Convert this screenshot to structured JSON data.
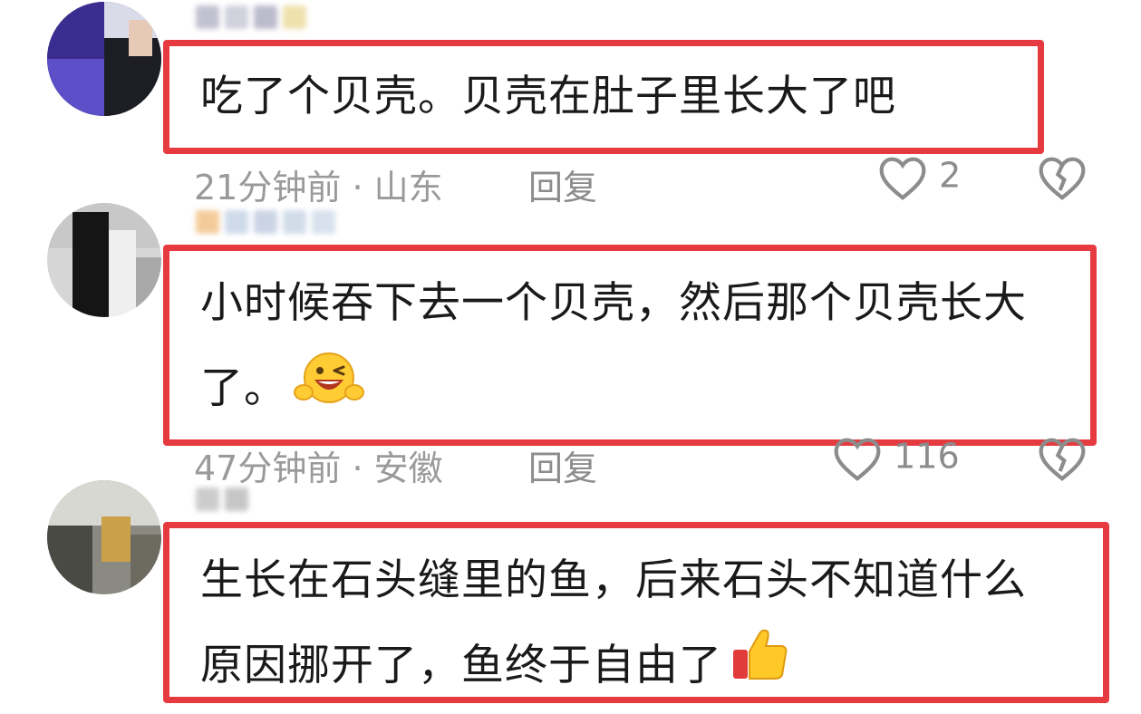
{
  "comments": [
    {
      "text_lines": [
        "吃了个贝壳。贝壳在肚子里长大了吧"
      ],
      "time": "21分钟前",
      "location": "山东",
      "reply_label": "回复",
      "likes": "2"
    },
    {
      "text_lines": [
        "小时候吞下去一个贝壳，然后那个贝壳长大",
        "了。"
      ],
      "time": "47分钟前",
      "location": "安徽",
      "reply_label": "回复",
      "likes": "116",
      "emoji": "grinning-face-with-v-hands"
    },
    {
      "text_lines": [
        "生长在石头缝里的鱼，后来石头不知道什么",
        "原因挪开了，鱼终于自由了"
      ],
      "emoji": "thumbs-up"
    }
  ],
  "meta_separator": "·",
  "icons": {
    "like": "heart-outline-icon",
    "dislike": "broken-heart-icon"
  },
  "colors": {
    "highlight_border": "#e53a3f",
    "meta_text": "#9a9a9a"
  }
}
